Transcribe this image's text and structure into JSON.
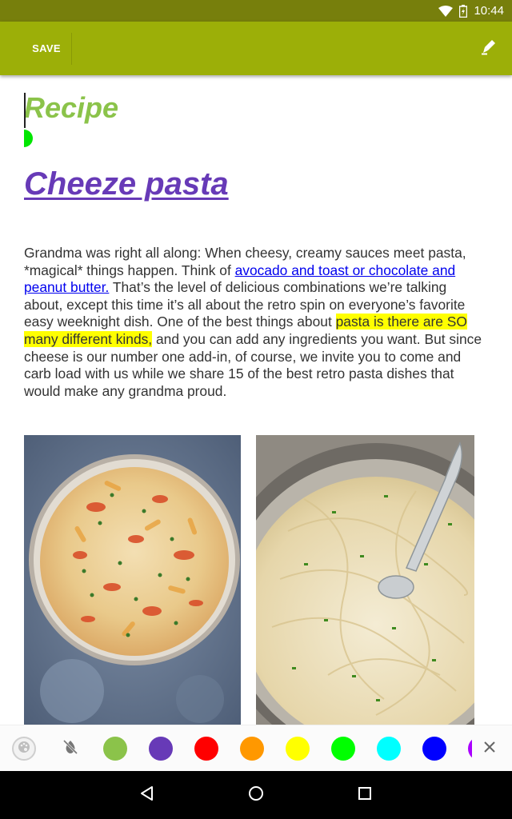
{
  "status_bar": {
    "time": "10:44",
    "icons": [
      "wifi-icon",
      "battery-icon"
    ]
  },
  "toolbar": {
    "save_label": "SAVE",
    "color": "#9caf08",
    "right_icon": "pen-icon"
  },
  "editor": {
    "heading": "Recipe",
    "heading_color": "#8bc34a",
    "title": "Cheeze pasta",
    "title_color": "#673ab7",
    "paragraph": {
      "intro": "Grandma was right all along: When cheesy, creamy sauces meet pasta, *magical* things happen. Think of ",
      "link": "avocado and toast or chocolate and peanut butter.",
      "middle": " That’s the level of delicious combinations we’re talking about, except this time it’s all about the retro spin on everyone’s favorite easy weeknight dish. One of the best things about ",
      "highlight": "pasta is there are SO many different kinds,",
      "ending": " and you can add any ingredients you want. But since cheese is our number one add-in, of course, we invite you to come and carb load with us while we share 15 of the best retro pasta dishes that would make any grandma proud."
    },
    "highlight_color": "#ffff00",
    "link_color": "#0000ee"
  },
  "color_bar": {
    "tools": [
      "palette-icon",
      "no-color-icon"
    ],
    "colors": [
      {
        "name": "light-green",
        "hex": "#8bc34a"
      },
      {
        "name": "purple",
        "hex": "#673ab7"
      },
      {
        "name": "red",
        "hex": "#ff0000"
      },
      {
        "name": "orange",
        "hex": "#ff9800"
      },
      {
        "name": "yellow",
        "hex": "#ffff00"
      },
      {
        "name": "green",
        "hex": "#00ff00"
      },
      {
        "name": "cyan",
        "hex": "#00ffff"
      },
      {
        "name": "blue",
        "hex": "#0000ff"
      },
      {
        "name": "violet",
        "hex": "#aa00ff"
      }
    ],
    "close_icon": "close-icon"
  },
  "nav_bar": {
    "icons": [
      "back-icon",
      "home-icon",
      "recents-icon"
    ]
  }
}
